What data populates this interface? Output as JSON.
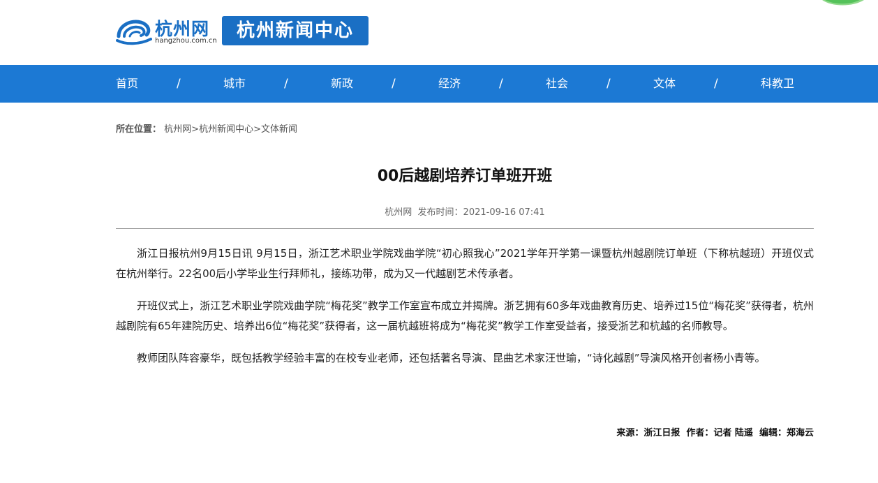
{
  "header": {
    "logo_name": "杭州网",
    "logo_domain": "hangzhou.com.cn",
    "center_badge": "杭州新闻中心"
  },
  "nav": {
    "items": [
      "首页",
      "城市",
      "新政",
      "经济",
      "社会",
      "文体",
      "科教卫"
    ],
    "separator": "/"
  },
  "breadcrumb": {
    "label": "所在位置：",
    "links": [
      "杭州网",
      "杭州新闻中心",
      "文体新闻"
    ],
    "separator": ">"
  },
  "article": {
    "title": "00后越剧培养订单班开班",
    "meta": "杭州网  发布时间：2021-09-16 07:41",
    "paragraphs": [
      "浙江日报杭州9月15日讯 9月15日，浙江艺术职业学院戏曲学院“初心照我心”2021学年开学第一课暨杭州越剧院订单班（下称杭越班）开班仪式在杭州举行。22名00后小学毕业生行拜师礼，接练功带，成为又一代越剧艺术传承者。",
      "开班仪式上，浙江艺术职业学院戏曲学院“梅花奖”教学工作室宣布成立并揭牌。浙艺拥有60多年戏曲教育历史、培养过15位“梅花奖”获得者，杭州越剧院有65年建院历史、培养出6位“梅花奖”获得者，这一届杭越班将成为“梅花奖”教学工作室受益者，接受浙艺和杭越的名师教导。",
      "教师团队阵容豪华，既包括教学经验丰富的在校专业老师，还包括著名导演、昆曲艺术家汪世瑜，“诗化越剧”导演风格开创者杨小青等。"
    ],
    "credits": "来源：浙江日报  作者：记者 陆遥  编辑：郑海云"
  },
  "colors": {
    "brand_blue": "#1a6fc4",
    "nav_blue": "#1c79d4"
  }
}
